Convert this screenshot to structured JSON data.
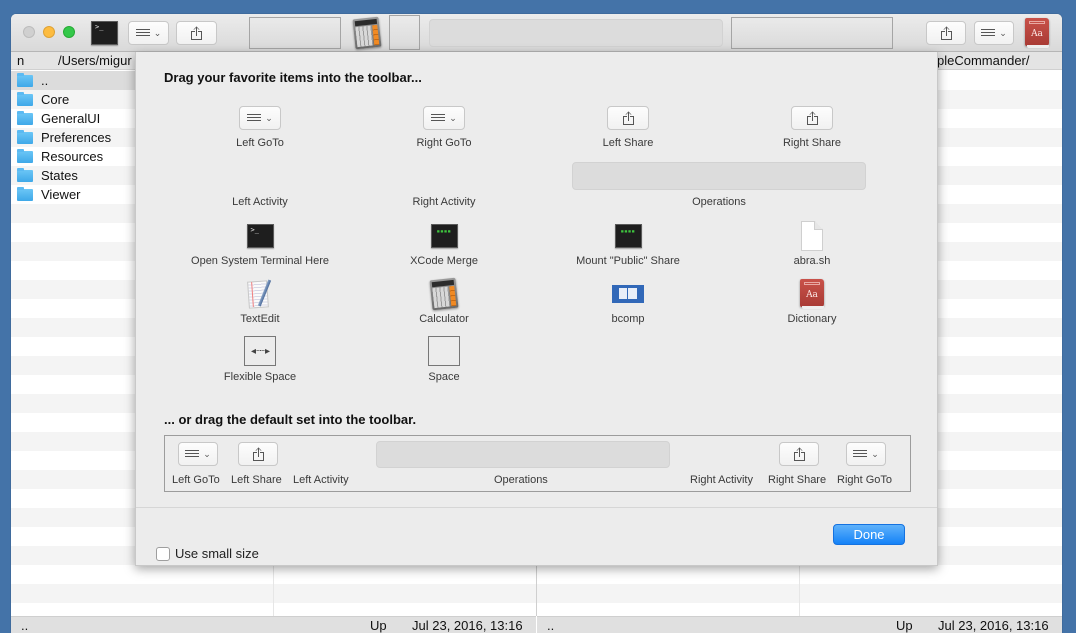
{
  "window": {
    "left_path_partial": "/Users/migur",
    "left_header_col": "n",
    "right_path_partial": "pleCommander/",
    "files": [
      {
        "name": "..",
        "selected": true
      },
      {
        "name": "Core"
      },
      {
        "name": "GeneralUI"
      },
      {
        "name": "Preferences"
      },
      {
        "name": "Resources"
      },
      {
        "name": "States"
      },
      {
        "name": "Viewer"
      }
    ],
    "status_left": {
      "name": "..",
      "kind": "Up",
      "date": "Jul 23, 2016, 13:16"
    },
    "status_right": {
      "name": "..",
      "kind": "Up",
      "date": "Jul 23, 2016, 13:16"
    }
  },
  "sheet": {
    "heading": "Drag your favorite items into the toolbar...",
    "items": [
      {
        "label": "Left GoTo",
        "icon": "goto-menu-icon"
      },
      {
        "label": "Right GoTo",
        "icon": "goto-menu-icon"
      },
      {
        "label": "Left Share",
        "icon": "share-icon"
      },
      {
        "label": "Right Share",
        "icon": "share-icon"
      },
      {
        "label": "Left Activity",
        "icon": "none"
      },
      {
        "label": "Right Activity",
        "icon": "none"
      },
      {
        "label": "Operations",
        "icon": "operations-well"
      },
      {
        "label": "Open System Terminal Here",
        "icon": "terminal-icon"
      },
      {
        "label": "XCode Merge",
        "icon": "script-icon"
      },
      {
        "label": "Mount \"Public\" Share",
        "icon": "script-icon"
      },
      {
        "label": "abra.sh",
        "icon": "document-icon"
      },
      {
        "label": "TextEdit",
        "icon": "textedit-icon"
      },
      {
        "label": "Calculator",
        "icon": "calculator-icon"
      },
      {
        "label": "bcomp",
        "icon": "bcomp-icon"
      },
      {
        "label": "Dictionary",
        "icon": "dictionary-icon"
      },
      {
        "label": "Flexible Space",
        "icon": "flexible-space-icon"
      },
      {
        "label": "Space",
        "icon": "space-icon"
      }
    ],
    "default_heading": "... or drag the default set into the toolbar.",
    "default_set": [
      {
        "label": "Left GoTo"
      },
      {
        "label": "Left Share"
      },
      {
        "label": "Left Activity"
      },
      {
        "label": "Operations"
      },
      {
        "label": "Right Activity"
      },
      {
        "label": "Right Share"
      },
      {
        "label": "Right GoTo"
      }
    ],
    "checkbox_label": "Use small size",
    "checkbox_checked": false,
    "done_label": "Done"
  },
  "colors": {
    "desktop": "#4473a8",
    "accent": "#1582f7",
    "folder": "#3ea8e8"
  }
}
